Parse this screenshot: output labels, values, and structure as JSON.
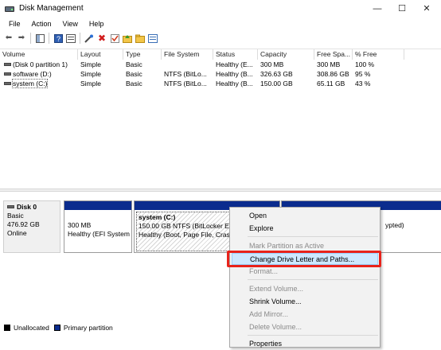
{
  "window": {
    "title": "Disk Management",
    "controls": {
      "minimize": "—",
      "maximize": "☐",
      "close": "✕"
    }
  },
  "menu": [
    "File",
    "Action",
    "View",
    "Help"
  ],
  "toolbar_icons": [
    "back-arrow-icon",
    "forward-arrow-icon",
    "console-tree-icon",
    "help-icon",
    "properties-icon",
    "connect-icon",
    "delete-icon",
    "check-icon",
    "folder-up-icon",
    "folder-icon",
    "list-icon"
  ],
  "volume_list": {
    "headers": [
      "Volume",
      "Layout",
      "Type",
      "File System",
      "Status",
      "Capacity",
      "Free Spa...",
      "% Free"
    ],
    "rows": [
      [
        "(Disk 0 partition 1)",
        "Simple",
        "Basic",
        "",
        "Healthy (E...",
        "300 MB",
        "300 MB",
        "100 %"
      ],
      [
        "software (D:)",
        "Simple",
        "Basic",
        "NTFS (BitLo...",
        "Healthy (B...",
        "326.63 GB",
        "308.86 GB",
        "95 %"
      ],
      [
        "system (C:)",
        "Simple",
        "Basic",
        "NTFS (BitLo...",
        "Healthy (B...",
        "150.00 GB",
        "65.11 GB",
        "43 %"
      ]
    ]
  },
  "disk": {
    "name": "Disk 0",
    "type": "Basic",
    "size": "476.92 GB",
    "status": "Online",
    "partitions": [
      {
        "line1": "",
        "line2": "300 MB",
        "line3": "Healthy (EFI System"
      },
      {
        "line1": "system  (C:)",
        "line2": "150.00 GB NTFS (BitLocker Enc",
        "line3": "Healthy (Boot, Page File, Cras"
      },
      {
        "line1": "",
        "line2": "",
        "line3": "ypted)"
      }
    ]
  },
  "legend": [
    {
      "label": "Unallocated",
      "color": "#000000"
    },
    {
      "label": "Primary partition",
      "color": "#0b2c8e"
    }
  ],
  "context_menu": [
    {
      "label": "Open",
      "enabled": true
    },
    {
      "label": "Explore",
      "enabled": true
    },
    {
      "label": "Mark Partition as Active",
      "enabled": false
    },
    {
      "label": "Change Drive Letter and Paths...",
      "enabled": true,
      "highlighted": true
    },
    {
      "label": "Format...",
      "enabled": false
    },
    {
      "label": "Extend Volume...",
      "enabled": false
    },
    {
      "label": "Shrink Volume...",
      "enabled": true
    },
    {
      "label": "Add Mirror...",
      "enabled": false
    },
    {
      "label": "Delete Volume...",
      "enabled": false
    },
    {
      "label": "Properties",
      "enabled": true
    }
  ],
  "colors": {
    "primary_partition": "#0b2c8e",
    "highlight_outline": "#e8231b",
    "menu_hover": "#cde8ff"
  }
}
